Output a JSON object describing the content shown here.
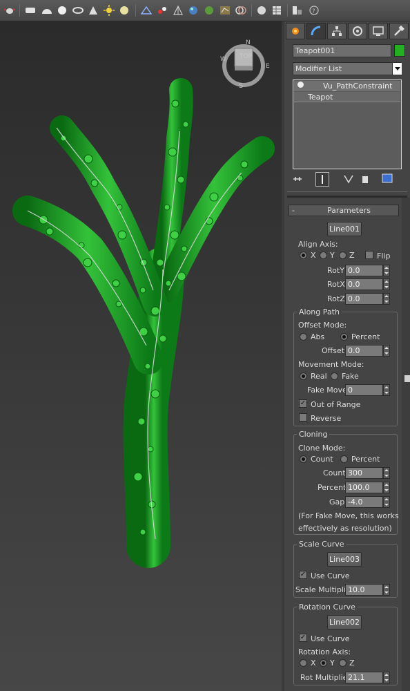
{
  "toolbar": {
    "icons": [
      "teapot-render-icon",
      "box-icon",
      "dome-icon",
      "sphere-icon",
      "cone-icon",
      "spot-icon",
      "sun-icon",
      "circle-light-icon",
      "grid-icon",
      "link-icon",
      "hierarchy-icon",
      "globe-icon",
      "tree-icon",
      "map-icon",
      "rings-icon",
      "sphere-material-icon",
      "spreadsheet-icon",
      "panel-icon",
      "help-icon"
    ]
  },
  "viewcube": {
    "face": "TOP",
    "north": "N",
    "west": "W",
    "east": "E",
    "south": "S"
  },
  "object": {
    "name": "Teapot001",
    "color": "#22b022"
  },
  "modifier_list": {
    "label": "Modifier List"
  },
  "stack": {
    "items": [
      "Vu_PathConstraint",
      "Teapot"
    ]
  },
  "parameters": {
    "rollout_title": "Parameters",
    "path_button": "Line001",
    "align_axis_label": "Align Axis:",
    "align_options": [
      "X",
      "Y",
      "Z"
    ],
    "align_selected": "X",
    "flip_label": "Flip",
    "flip_checked": false,
    "roty_label": "RotY",
    "roty_value": "0.0",
    "rotx_label": "RotX",
    "rotx_value": "0.0",
    "rotz_label": "RotZ",
    "rotz_value": "0.0",
    "along_path": {
      "title": "Along Path",
      "offset_mode_label": "Offset Mode:",
      "offset_options": [
        "Abs",
        "Percent"
      ],
      "offset_selected": "Percent",
      "offset_label": "Offset",
      "offset_value": "0.0",
      "movement_mode_label": "Movement Mode:",
      "movement_options": [
        "Real",
        "Fake"
      ],
      "movement_selected": "Real",
      "fake_move_label": "Fake Move",
      "fake_move_value": "0",
      "out_of_range_label": "Out of Range",
      "out_of_range_checked": true,
      "reverse_label": "Reverse",
      "reverse_checked": false
    },
    "cloning": {
      "title": "Cloning",
      "clone_mode_label": "Clone Mode:",
      "clone_options": [
        "Count",
        "Percent"
      ],
      "clone_selected": "Count",
      "count_label": "Count",
      "count_value": "300",
      "percent_label": "Percent",
      "percent_value": "100.0",
      "gap_label": "Gap",
      "gap_value": "-4.0",
      "note_line1": "(For Fake Move, this works",
      "note_line2": "effectively as resolution)"
    },
    "scale_curve": {
      "title": "Scale Curve",
      "curve_button": "Line003",
      "use_curve_label": "Use Curve",
      "use_curve_checked": true,
      "multiplier_label": "Scale Multiplier",
      "multiplier_value": "10.0"
    },
    "rotation_curve": {
      "title": "Rotation Curve",
      "curve_button": "Line002",
      "use_curve_label": "Use Curve",
      "use_curve_checked": true,
      "axis_label": "Rotation Axis:",
      "axis_options": [
        "X",
        "Y",
        "Z"
      ],
      "axis_selected": "Y",
      "multiplier_label": "Rot Multiplier",
      "multiplier_value": "21.1"
    }
  }
}
